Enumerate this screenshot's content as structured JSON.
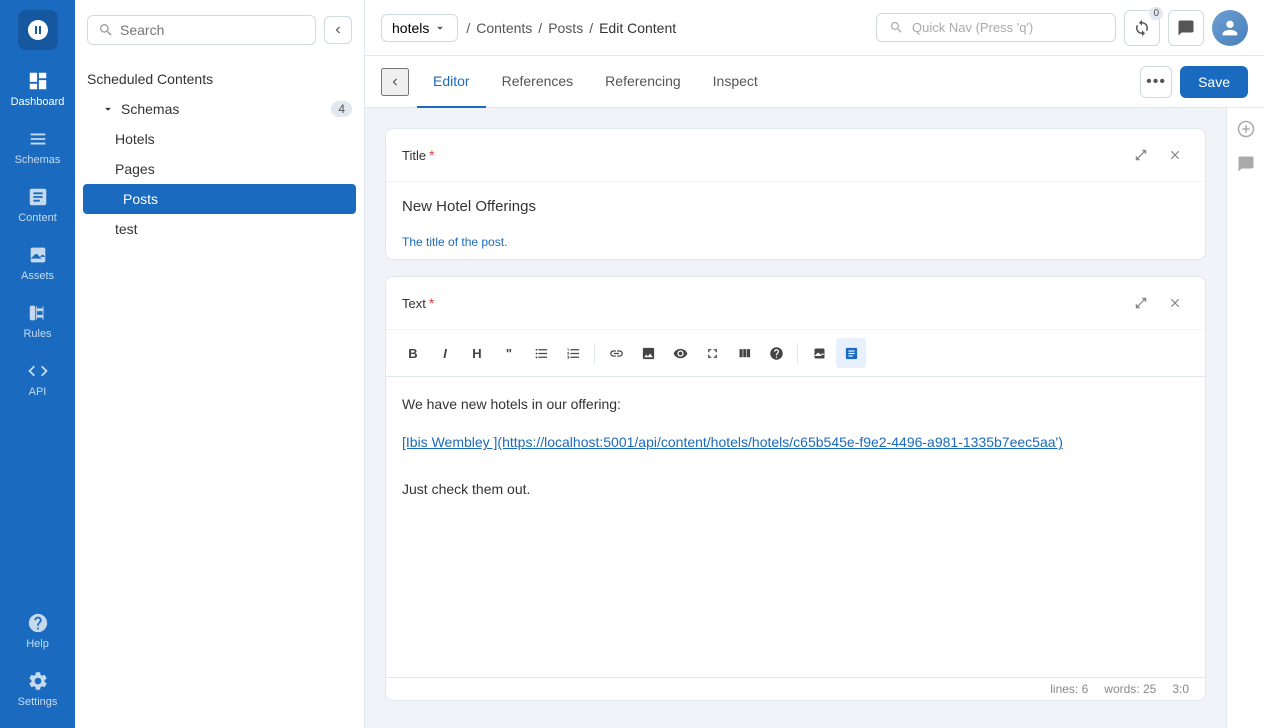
{
  "app": {
    "name": "hotels",
    "logo_label": "squidex-logo"
  },
  "breadcrumb": {
    "items": [
      "Contents",
      "Posts",
      "Edit Content"
    ]
  },
  "quick_nav": {
    "placeholder": "Quick Nav (Press 'q')"
  },
  "top_bar": {
    "sync_label": "0",
    "upload_count": "0"
  },
  "sidebar": {
    "search_placeholder": "Search",
    "section_label": "Scheduled Contents",
    "schemas_label": "Schemas",
    "schemas_count": "4",
    "items": [
      {
        "label": "Hotels",
        "indent": false
      },
      {
        "label": "Pages",
        "indent": false
      },
      {
        "label": "Posts",
        "indent": false,
        "active": true
      },
      {
        "label": "test",
        "indent": false
      }
    ]
  },
  "tabs": {
    "items": [
      "Editor",
      "References",
      "Referencing",
      "Inspect"
    ],
    "active": "Editor"
  },
  "toolbar": {
    "more_label": "•••",
    "save_label": "Save"
  },
  "title_field": {
    "label": "Title",
    "required": true,
    "value": "New Hotel Offerings",
    "hint": "The title of the post."
  },
  "text_field": {
    "label": "Text",
    "required": true,
    "content_line1": "We have new hotels in our offering:",
    "content_line2": "[Ibis Wembley ](https://localhost:5001/api/content/hotels/hotels/c65b545e-f9e2-4496-a981-1335b7eec5aa')",
    "content_line3": "Just check them out.",
    "link_text": "Ibis Wembley ",
    "link_url": "https://localhost:5001/api/content/hotels/hotels/c65b545e-f9e2-4496-a981-1335b7eec5aa'",
    "status_lines": "lines: 6",
    "status_words": "words: 25",
    "status_pos": "3:0"
  },
  "nav": {
    "dashboard_label": "Dashboard",
    "schemas_label": "Schemas",
    "content_label": "Content",
    "assets_label": "Assets",
    "rules_label": "Rules",
    "api_label": "API",
    "help_label": "Help",
    "settings_label": "Settings"
  },
  "colors": {
    "accent": "#1a6abf",
    "nav_bg": "#1a6abf",
    "active_tab": "#1a6abf"
  }
}
